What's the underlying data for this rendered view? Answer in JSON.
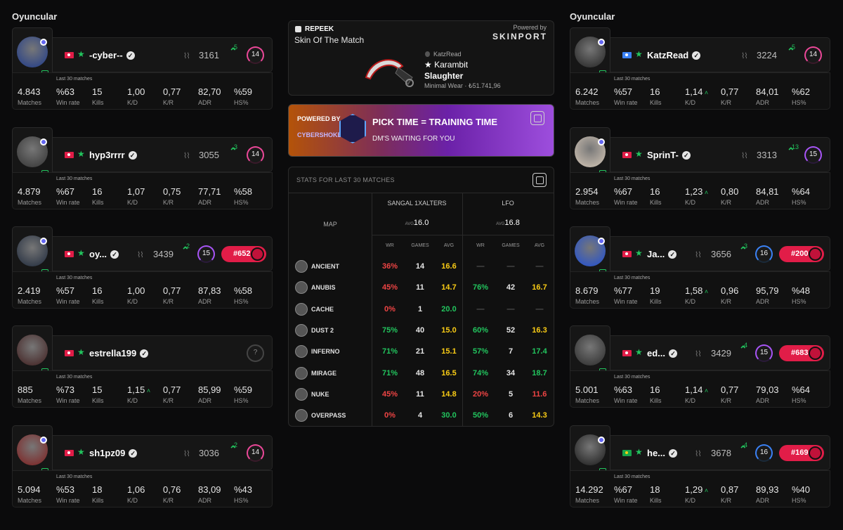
{
  "left_title": "Oyuncular",
  "right_title": "Oyuncular",
  "stat_labels": {
    "matches": "Matches",
    "winrate": "Win rate",
    "kills": "Kills",
    "kd": "K/D",
    "kr": "K/R",
    "adr": "ADR",
    "hs": "HS%",
    "last30": "Last 30 matches"
  },
  "left_players": [
    {
      "name": "-cyber--",
      "elo": "3161",
      "delta": "5",
      "level": "14",
      "matches": "4.843",
      "winrate": "%63",
      "kills": "15",
      "kd": "1,00",
      "kr": "0,77",
      "adr": "82,70",
      "hs": "%59"
    },
    {
      "name": "hyp3rrrr",
      "elo": "3055",
      "delta": "3",
      "level": "14",
      "matches": "4.879",
      "winrate": "%67",
      "kills": "16",
      "kd": "1,07",
      "kr": "0,75",
      "adr": "77,71",
      "hs": "%58"
    },
    {
      "name": "oy...",
      "elo": "3439",
      "delta": "2",
      "level": "15",
      "rank": "#652",
      "matches": "2.419",
      "winrate": "%57",
      "kills": "16",
      "kd": "1,00",
      "kr": "0,77",
      "adr": "87,83",
      "hs": "%58"
    },
    {
      "name": "estrella199",
      "level": "?",
      "matches": "885",
      "winrate": "%73",
      "kills": "15",
      "kd": "1,15",
      "kr": "0,77",
      "adr": "85,99",
      "hs": "%59"
    },
    {
      "name": "sh1pz09",
      "elo": "3036",
      "delta": "2",
      "level": "14",
      "matches": "5.094",
      "winrate": "%53",
      "kills": "18",
      "kd": "1,06",
      "kr": "0,76",
      "adr": "83,09",
      "hs": "%43"
    }
  ],
  "right_players": [
    {
      "name": "KatzRead",
      "elo": "3224",
      "delta": "5",
      "level": "14",
      "matches": "6.242",
      "winrate": "%57",
      "kills": "16",
      "kd": "1,14",
      "kr": "0,77",
      "adr": "84,01",
      "hs": "%62"
    },
    {
      "name": "SprinT-",
      "elo": "3313",
      "delta": "13",
      "level": "15",
      "matches": "2.954",
      "winrate": "%67",
      "kills": "16",
      "kd": "1,23",
      "kr": "0,80",
      "adr": "84,81",
      "hs": "%64"
    },
    {
      "name": "Ja...",
      "elo": "3656",
      "delta": "3",
      "level": "16",
      "rank": "#200",
      "matches": "8.679",
      "winrate": "%77",
      "kills": "19",
      "kd": "1,58",
      "kr": "0,96",
      "adr": "95,79",
      "hs": "%48"
    },
    {
      "name": "ed...",
      "elo": "3429",
      "delta": "4",
      "level": "15",
      "rank": "#683",
      "matches": "5.001",
      "winrate": "%63",
      "kills": "16",
      "kd": "1,14",
      "kr": "0,77",
      "adr": "79,03",
      "hs": "%64"
    },
    {
      "name": "he...",
      "elo": "3678",
      "delta": "4",
      "level": "16",
      "rank": "#169",
      "matches": "14.292",
      "winrate": "%67",
      "kills": "18",
      "kd": "1,29",
      "kr": "0,87",
      "adr": "89,93",
      "hs": "%40"
    }
  ],
  "potm": {
    "brand": "REPEEK",
    "title": "Skin Of The Match",
    "powered": "Powered by",
    "sponsor": "SKINPORT",
    "owner": "KatzRead",
    "item1": "★ Karambit",
    "item2": "Slaughter",
    "wear": "Minimal Wear · ₺51.741,96"
  },
  "promo": {
    "powered_by": "POWERED BY",
    "brand": "CYBERSHOKE",
    "headline": "PICK TIME = TRAINING TIME",
    "sub": "DM'S WAITING FOR YOU"
  },
  "stats": {
    "header": "STATS FOR LAST 30 MATCHES",
    "map_label": "MAP",
    "team1": "SANGAL 1XALTERS",
    "team1_avg_label": "AVG",
    "team1_avg": "16.0",
    "team2": "LFO",
    "team2_avg_label": "AVG",
    "team2_avg": "16.8",
    "col_wr": "WR",
    "col_games": "GAMES",
    "col_avg": "AVG",
    "maps": [
      {
        "name": "ANCIENT",
        "t1": [
          "36%",
          "14",
          "16.6"
        ],
        "t2": [
          "—",
          "—",
          "—"
        ]
      },
      {
        "name": "ANUBIS",
        "t1": [
          "45%",
          "11",
          "14.7"
        ],
        "t2": [
          "76%",
          "42",
          "16.7"
        ]
      },
      {
        "name": "CACHE",
        "t1": [
          "0%",
          "1",
          "20.0"
        ],
        "t2": [
          "—",
          "—",
          "—"
        ]
      },
      {
        "name": "DUST 2",
        "t1": [
          "75%",
          "40",
          "15.0"
        ],
        "t2": [
          "60%",
          "52",
          "16.3"
        ]
      },
      {
        "name": "INFERNO",
        "t1": [
          "71%",
          "21",
          "15.1"
        ],
        "t2": [
          "57%",
          "7",
          "17.4"
        ]
      },
      {
        "name": "MIRAGE",
        "t1": [
          "71%",
          "48",
          "16.5"
        ],
        "t2": [
          "74%",
          "34",
          "18.7"
        ]
      },
      {
        "name": "NUKE",
        "t1": [
          "45%",
          "11",
          "14.8"
        ],
        "t2": [
          "20%",
          "5",
          "11.6"
        ]
      },
      {
        "name": "OVERPASS",
        "t1": [
          "0%",
          "4",
          "30.0"
        ],
        "t2": [
          "50%",
          "6",
          "14.3"
        ]
      }
    ]
  }
}
